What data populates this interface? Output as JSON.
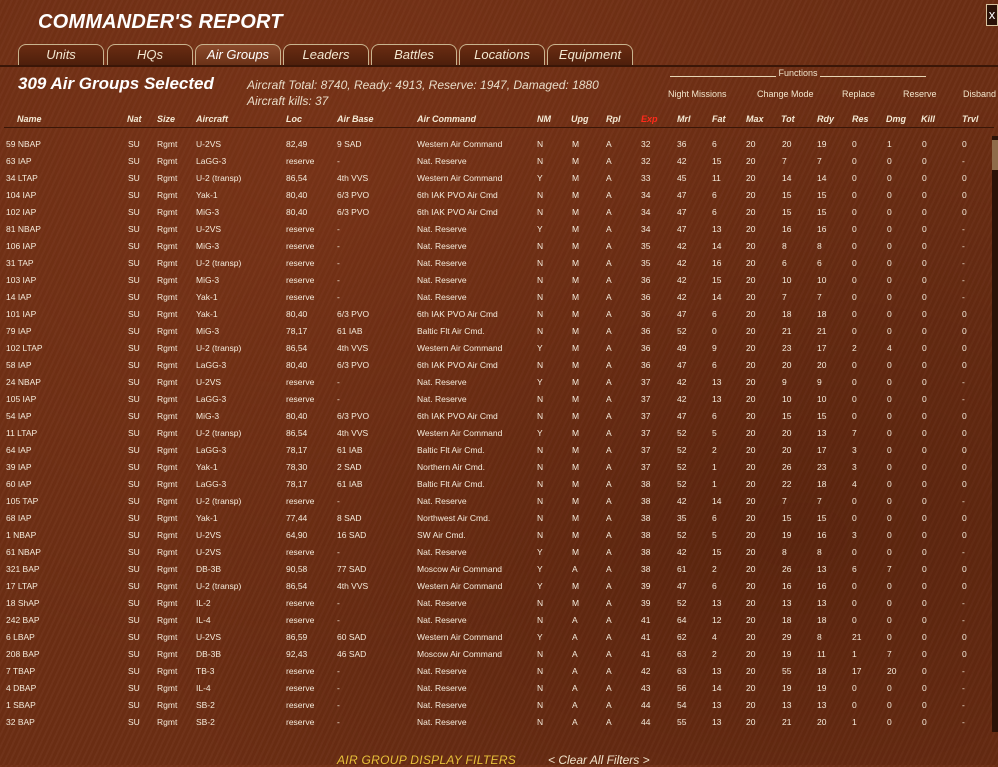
{
  "app": {
    "title": "COMMANDER'S REPORT",
    "close_label": "x"
  },
  "tabs": [
    {
      "label": "Units"
    },
    {
      "label": "HQs"
    },
    {
      "label": "Air Groups",
      "active": true
    },
    {
      "label": "Leaders"
    },
    {
      "label": "Battles"
    },
    {
      "label": "Locations"
    },
    {
      "label": "Equipment"
    }
  ],
  "summary": {
    "selected": "309 Air Groups Selected",
    "line1": "Aircraft Total: 8740, Ready: 4913, Reserve: 1947, Damaged: 1880",
    "line2": "Aircraft kills: 37"
  },
  "functions": {
    "label": "Functions",
    "buttons": [
      "Night Missions",
      "Change Mode",
      "Replace",
      "Reserve",
      "Disband"
    ]
  },
  "columns": [
    "Name",
    "Nat",
    "Size",
    "Aircraft",
    "Loc",
    "Air Base",
    "Air Command",
    "NM",
    "Upg",
    "Rpl",
    "Exp",
    "Mrl",
    "Fat",
    "Max",
    "Tot",
    "Rdy",
    "Res",
    "Dmg",
    "Kill",
    "Trvl"
  ],
  "highlight_column": "Exp",
  "colors": {
    "background": "#6d2e14",
    "highlight_header": "#ff2a1a",
    "filters_title": "#e8c23a"
  },
  "rows": [
    [
      "59 NBAP",
      "SU",
      "Rgmt",
      "U-2VS",
      "82,49",
      "9 SAD",
      "Western Air Command",
      "N",
      "M",
      "A",
      "32",
      "36",
      "6",
      "20",
      "20",
      "19",
      "0",
      "1",
      "0",
      "0"
    ],
    [
      "63 IAP",
      "SU",
      "Rgmt",
      "LaGG-3",
      "reserve",
      "-",
      "Nat. Reserve",
      "N",
      "M",
      "A",
      "32",
      "42",
      "15",
      "20",
      "7",
      "7",
      "0",
      "0",
      "0",
      "-"
    ],
    [
      "34 LTAP",
      "SU",
      "Rgmt",
      "U-2 (transp)",
      "86,54",
      "4th VVS",
      "Western Air Command",
      "Y",
      "M",
      "A",
      "33",
      "45",
      "11",
      "20",
      "14",
      "14",
      "0",
      "0",
      "0",
      "0"
    ],
    [
      "104 IAP",
      "SU",
      "Rgmt",
      "Yak-1",
      "80,40",
      "6/3 PVO",
      "6th IAK PVO Air Cmd",
      "N",
      "M",
      "A",
      "34",
      "47",
      "6",
      "20",
      "15",
      "15",
      "0",
      "0",
      "0",
      "0"
    ],
    [
      "102 IAP",
      "SU",
      "Rgmt",
      "MiG-3",
      "80,40",
      "6/3 PVO",
      "6th IAK PVO Air Cmd",
      "N",
      "M",
      "A",
      "34",
      "47",
      "6",
      "20",
      "15",
      "15",
      "0",
      "0",
      "0",
      "0"
    ],
    [
      "81 NBAP",
      "SU",
      "Rgmt",
      "U-2VS",
      "reserve",
      "-",
      "Nat. Reserve",
      "Y",
      "M",
      "A",
      "34",
      "47",
      "13",
      "20",
      "16",
      "16",
      "0",
      "0",
      "0",
      "-"
    ],
    [
      "106 IAP",
      "SU",
      "Rgmt",
      "MiG-3",
      "reserve",
      "-",
      "Nat. Reserve",
      "N",
      "M",
      "A",
      "35",
      "42",
      "14",
      "20",
      "8",
      "8",
      "0",
      "0",
      "0",
      "-"
    ],
    [
      "31 TAP",
      "SU",
      "Rgmt",
      "U-2 (transp)",
      "reserve",
      "-",
      "Nat. Reserve",
      "N",
      "M",
      "A",
      "35",
      "42",
      "16",
      "20",
      "6",
      "6",
      "0",
      "0",
      "0",
      "-"
    ],
    [
      "103 IAP",
      "SU",
      "Rgmt",
      "MiG-3",
      "reserve",
      "-",
      "Nat. Reserve",
      "N",
      "M",
      "A",
      "36",
      "42",
      "15",
      "20",
      "10",
      "10",
      "0",
      "0",
      "0",
      "-"
    ],
    [
      "14 IAP",
      "SU",
      "Rgmt",
      "Yak-1",
      "reserve",
      "-",
      "Nat. Reserve",
      "N",
      "M",
      "A",
      "36",
      "42",
      "14",
      "20",
      "7",
      "7",
      "0",
      "0",
      "0",
      "-"
    ],
    [
      "101 IAP",
      "SU",
      "Rgmt",
      "Yak-1",
      "80,40",
      "6/3 PVO",
      "6th IAK PVO Air Cmd",
      "N",
      "M",
      "A",
      "36",
      "47",
      "6",
      "20",
      "18",
      "18",
      "0",
      "0",
      "0",
      "0"
    ],
    [
      "79 IAP",
      "SU",
      "Rgmt",
      "MiG-3",
      "78,17",
      "61 IAB",
      "Baltic Flt Air Cmd.",
      "N",
      "M",
      "A",
      "36",
      "52",
      "0",
      "20",
      "21",
      "21",
      "0",
      "0",
      "0",
      "0"
    ],
    [
      "102 LTAP",
      "SU",
      "Rgmt",
      "U-2 (transp)",
      "86,54",
      "4th VVS",
      "Western Air Command",
      "Y",
      "M",
      "A",
      "36",
      "49",
      "9",
      "20",
      "23",
      "17",
      "2",
      "4",
      "0",
      "0"
    ],
    [
      "58 IAP",
      "SU",
      "Rgmt",
      "LaGG-3",
      "80,40",
      "6/3 PVO",
      "6th IAK PVO Air Cmd",
      "N",
      "M",
      "A",
      "36",
      "47",
      "6",
      "20",
      "20",
      "20",
      "0",
      "0",
      "0",
      "0"
    ],
    [
      "24 NBAP",
      "SU",
      "Rgmt",
      "U-2VS",
      "reserve",
      "-",
      "Nat. Reserve",
      "Y",
      "M",
      "A",
      "37",
      "42",
      "13",
      "20",
      "9",
      "9",
      "0",
      "0",
      "0",
      "-"
    ],
    [
      "105 IAP",
      "SU",
      "Rgmt",
      "LaGG-3",
      "reserve",
      "-",
      "Nat. Reserve",
      "N",
      "M",
      "A",
      "37",
      "42",
      "13",
      "20",
      "10",
      "10",
      "0",
      "0",
      "0",
      "-"
    ],
    [
      "54 IAP",
      "SU",
      "Rgmt",
      "MiG-3",
      "80,40",
      "6/3 PVO",
      "6th IAK PVO Air Cmd",
      "N",
      "M",
      "A",
      "37",
      "47",
      "6",
      "20",
      "15",
      "15",
      "0",
      "0",
      "0",
      "0"
    ],
    [
      "11 LTAP",
      "SU",
      "Rgmt",
      "U-2 (transp)",
      "86,54",
      "4th VVS",
      "Western Air Command",
      "Y",
      "M",
      "A",
      "37",
      "52",
      "5",
      "20",
      "20",
      "13",
      "7",
      "0",
      "0",
      "0"
    ],
    [
      "64 IAP",
      "SU",
      "Rgmt",
      "LaGG-3",
      "78,17",
      "61 IAB",
      "Baltic Flt Air Cmd.",
      "N",
      "M",
      "A",
      "37",
      "52",
      "2",
      "20",
      "20",
      "17",
      "3",
      "0",
      "0",
      "0"
    ],
    [
      "39 IAP",
      "SU",
      "Rgmt",
      "Yak-1",
      "78,30",
      "2 SAD",
      "Northern Air Cmd.",
      "N",
      "M",
      "A",
      "37",
      "52",
      "1",
      "20",
      "26",
      "23",
      "3",
      "0",
      "0",
      "0"
    ],
    [
      "60 IAP",
      "SU",
      "Rgmt",
      "LaGG-3",
      "78,17",
      "61 IAB",
      "Baltic Flt Air Cmd.",
      "N",
      "M",
      "A",
      "38",
      "52",
      "1",
      "20",
      "22",
      "18",
      "4",
      "0",
      "0",
      "0"
    ],
    [
      "105 TAP",
      "SU",
      "Rgmt",
      "U-2 (transp)",
      "reserve",
      "-",
      "Nat. Reserve",
      "N",
      "M",
      "A",
      "38",
      "42",
      "14",
      "20",
      "7",
      "7",
      "0",
      "0",
      "0",
      "-"
    ],
    [
      "68 IAP",
      "SU",
      "Rgmt",
      "Yak-1",
      "77,44",
      "8 SAD",
      "Northwest Air Cmd.",
      "N",
      "M",
      "A",
      "38",
      "35",
      "6",
      "20",
      "15",
      "15",
      "0",
      "0",
      "0",
      "0"
    ],
    [
      "1 NBAP",
      "SU",
      "Rgmt",
      "U-2VS",
      "64,90",
      "16 SAD",
      "SW Air Cmd.",
      "N",
      "M",
      "A",
      "38",
      "52",
      "5",
      "20",
      "19",
      "16",
      "3",
      "0",
      "0",
      "0"
    ],
    [
      "61 NBAP",
      "SU",
      "Rgmt",
      "U-2VS",
      "reserve",
      "-",
      "Nat. Reserve",
      "Y",
      "M",
      "A",
      "38",
      "42",
      "15",
      "20",
      "8",
      "8",
      "0",
      "0",
      "0",
      "-"
    ],
    [
      "321 BAP",
      "SU",
      "Rgmt",
      "DB-3B",
      "90,58",
      "77 SAD",
      "Moscow Air Command",
      "Y",
      "A",
      "A",
      "38",
      "61",
      "2",
      "20",
      "26",
      "13",
      "6",
      "7",
      "0",
      "0"
    ],
    [
      "17 LTAP",
      "SU",
      "Rgmt",
      "U-2 (transp)",
      "86,54",
      "4th VVS",
      "Western Air Command",
      "Y",
      "M",
      "A",
      "39",
      "47",
      "6",
      "20",
      "16",
      "16",
      "0",
      "0",
      "0",
      "0"
    ],
    [
      "18 ShAP",
      "SU",
      "Rgmt",
      "IL-2",
      "reserve",
      "-",
      "Nat. Reserve",
      "N",
      "M",
      "A",
      "39",
      "52",
      "13",
      "20",
      "13",
      "13",
      "0",
      "0",
      "0",
      "-"
    ],
    [
      "242 BAP",
      "SU",
      "Rgmt",
      "IL-4",
      "reserve",
      "-",
      "Nat. Reserve",
      "N",
      "A",
      "A",
      "41",
      "64",
      "12",
      "20",
      "18",
      "18",
      "0",
      "0",
      "0",
      "-"
    ],
    [
      "6 LBAP",
      "SU",
      "Rgmt",
      "U-2VS",
      "86,59",
      "60 SAD",
      "Western Air Command",
      "Y",
      "A",
      "A",
      "41",
      "62",
      "4",
      "20",
      "29",
      "8",
      "21",
      "0",
      "0",
      "0"
    ],
    [
      "208 BAP",
      "SU",
      "Rgmt",
      "DB-3B",
      "92,43",
      "46 SAD",
      "Moscow Air Command",
      "N",
      "A",
      "A",
      "41",
      "63",
      "2",
      "20",
      "19",
      "11",
      "1",
      "7",
      "0",
      "0"
    ],
    [
      "7 TBAP",
      "SU",
      "Rgmt",
      "TB-3",
      "reserve",
      "-",
      "Nat. Reserve",
      "N",
      "A",
      "A",
      "42",
      "63",
      "13",
      "20",
      "55",
      "18",
      "17",
      "20",
      "0",
      "-"
    ],
    [
      "4 DBAP",
      "SU",
      "Rgmt",
      "IL-4",
      "reserve",
      "-",
      "Nat. Reserve",
      "N",
      "A",
      "A",
      "43",
      "56",
      "14",
      "20",
      "19",
      "19",
      "0",
      "0",
      "0",
      "-"
    ],
    [
      "1 SBAP",
      "SU",
      "Rgmt",
      "SB-2",
      "reserve",
      "-",
      "Nat. Reserve",
      "N",
      "A",
      "A",
      "44",
      "54",
      "13",
      "20",
      "13",
      "13",
      "0",
      "0",
      "0",
      "-"
    ],
    [
      "32 BAP",
      "SU",
      "Rgmt",
      "SB-2",
      "reserve",
      "-",
      "Nat. Reserve",
      "N",
      "A",
      "A",
      "44",
      "55",
      "13",
      "20",
      "21",
      "20",
      "1",
      "0",
      "0",
      "-"
    ]
  ],
  "filters": {
    "title": "AIR GROUP DISPLAY FILTERS",
    "clear": "< Clear All Filters >"
  }
}
